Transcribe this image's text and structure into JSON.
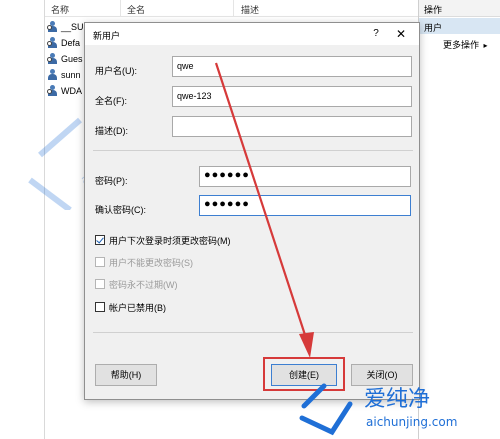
{
  "background": {
    "columns": [
      "名称",
      "全名",
      "描述"
    ],
    "rows": [
      "__SU",
      "Defa",
      "Gues",
      "sunn",
      "WDA"
    ]
  },
  "action_pane": {
    "title": "操作",
    "section": "用户",
    "more": "更多操作",
    "more_arrow": "▸"
  },
  "dialog": {
    "title": "新用户",
    "help_glyph": "?",
    "close_glyph": "✕",
    "username_label": "用户名(U):",
    "username_value": "qwe",
    "fullname_label": "全名(F):",
    "fullname_value": "qwe-123",
    "description_label": "描述(D):",
    "description_value": "",
    "password_label": "密码(P):",
    "password_value": "●●●●●●",
    "confirm_label": "确认密码(C):",
    "confirm_value": "●●●●●●",
    "options": [
      {
        "label": "用户下次登录时须更改密码(M)",
        "checked": true,
        "enabled": true
      },
      {
        "label": "用户不能更改密码(S)",
        "checked": false,
        "enabled": false
      },
      {
        "label": "密码永不过期(W)",
        "checked": false,
        "enabled": false
      },
      {
        "label": "帐户已禁用(B)",
        "checked": false,
        "enabled": true
      }
    ],
    "help_button": "帮助(H)",
    "create_button": "创建(E)",
    "close_button": "关闭(O)"
  },
  "watermark": {
    "brand": "爱纯净",
    "url": "aichunjing.com"
  },
  "colors": {
    "annotation_red": "#d63a3a",
    "focus_blue": "#3d7fd1",
    "watermark_blue": "#1f6fd6"
  }
}
